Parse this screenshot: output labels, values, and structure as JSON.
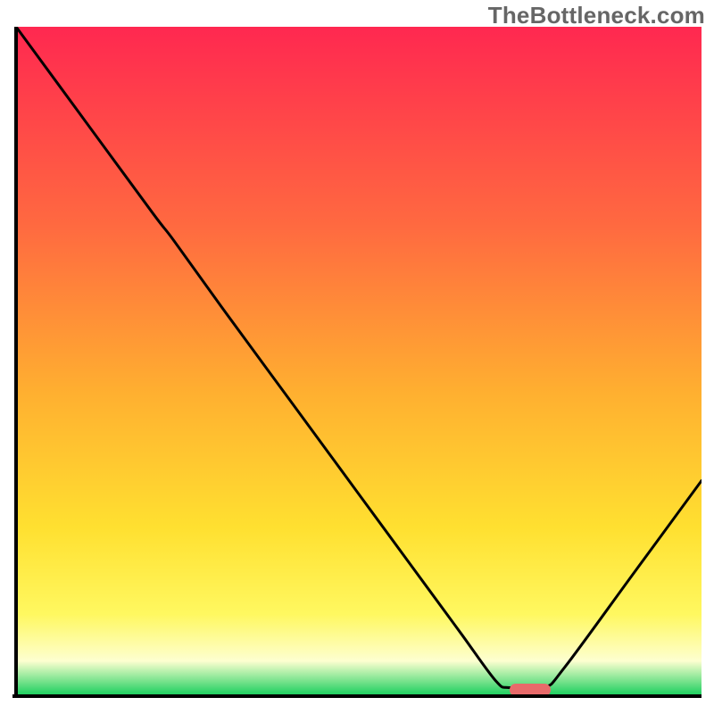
{
  "watermark": "TheBottleneck.com",
  "colors": {
    "grad_top": "#ff2850",
    "grad_mid1": "#ff6a40",
    "grad_mid2": "#ffb030",
    "grad_mid3": "#ffe030",
    "grad_low1": "#fff860",
    "grad_low2": "#fdffd0",
    "grad_bottom": "#20d060",
    "axis": "#000000",
    "curve": "#000000",
    "marker": "#e86a6a"
  },
  "chart_data": {
    "type": "line",
    "title": "",
    "xlabel": "",
    "ylabel": "",
    "x": [
      0.0,
      0.1,
      0.2,
      0.23,
      0.3,
      0.4,
      0.5,
      0.6,
      0.65,
      0.7,
      0.72,
      0.77,
      0.8,
      0.9,
      1.0
    ],
    "values": [
      1.0,
      0.86,
      0.72,
      0.68,
      0.58,
      0.44,
      0.3,
      0.16,
      0.09,
      0.02,
      0.01,
      0.01,
      0.04,
      0.18,
      0.32
    ],
    "ylim": [
      0,
      1
    ],
    "xlim": [
      0,
      1
    ],
    "marker_x_range": [
      0.72,
      0.78
    ],
    "grid": false,
    "legend": false
  }
}
